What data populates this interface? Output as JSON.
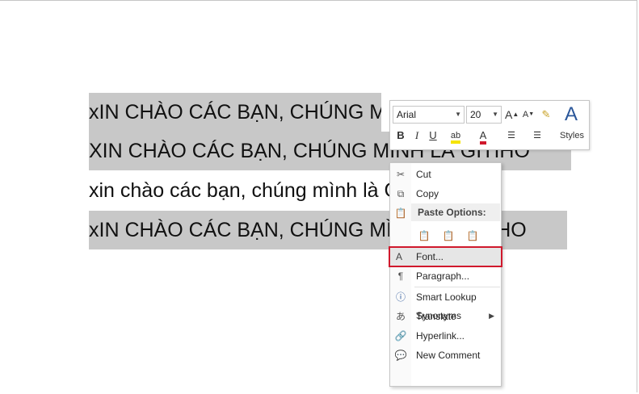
{
  "document": {
    "lines": [
      "xIN CHÀO CÁC BẠN, CHÚNG MÌNH LÀ GITIHO",
      "XIN CHÀO CÁC BẠN, CHÚNG MÌNH LÀ GITIHO",
      "xin chào các bạn, chúng mình là Gitiho",
      "xIN CHÀO CÁC BẠN, CHÚNG MÌNH LÀ GITIHO"
    ]
  },
  "mini_toolbar": {
    "font_name": "Arial",
    "font_size": "20",
    "grow_font": "A",
    "shrink_font": "A",
    "bold": "B",
    "italic": "I",
    "underline": "U",
    "highlight": "ab",
    "font_color": "A",
    "styles_label": "Styles"
  },
  "context_menu": {
    "cut": "Cut",
    "copy": "Copy",
    "paste_options": "Paste Options:",
    "font": "Font...",
    "paragraph": "Paragraph...",
    "smart_lookup": "Smart Lookup",
    "synonyms": "Synonyms",
    "translate": "Translate",
    "hyperlink": "Hyperlink...",
    "new_comment": "New Comment"
  },
  "colors": {
    "selection": "#c8c8c8",
    "highlight_border": "#d0192d",
    "icon_blue": "#2b579a"
  }
}
